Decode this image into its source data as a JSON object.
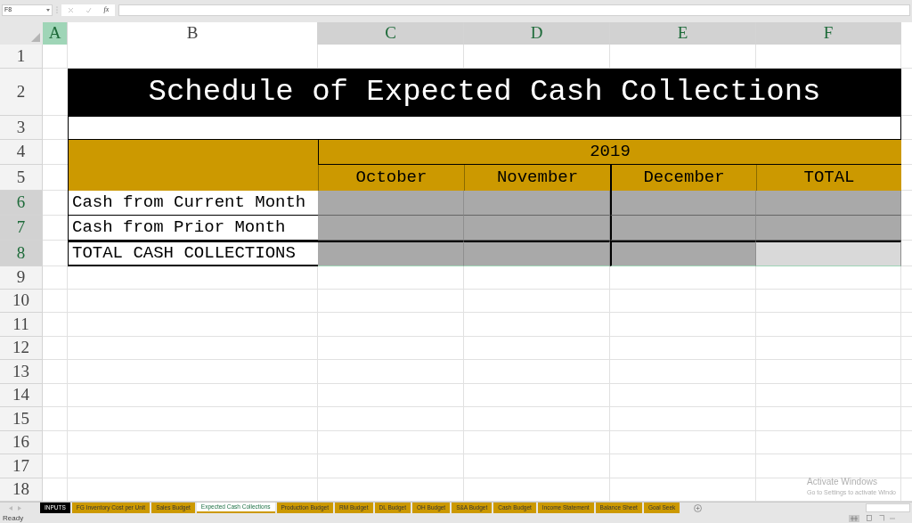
{
  "formula_bar": {
    "name_box": "F8",
    "fx_label": "fx"
  },
  "column_headers": [
    {
      "label": "A",
      "active": true,
      "selected": false
    },
    {
      "label": "B",
      "active": false,
      "selected": false
    },
    {
      "label": "C",
      "active": false,
      "selected": true
    },
    {
      "label": "D",
      "active": false,
      "selected": true
    },
    {
      "label": "E",
      "active": false,
      "selected": true
    },
    {
      "label": "F",
      "active": false,
      "selected": true
    }
  ],
  "rows": [
    {
      "header": "1",
      "kind": "blank",
      "selected": false
    },
    {
      "header": "2",
      "kind": "title",
      "selected": false,
      "text": "Schedule of Expected Cash Collections"
    },
    {
      "header": "3",
      "kind": "spacer",
      "selected": false
    },
    {
      "header": "4",
      "kind": "year",
      "selected": false,
      "text": "2019"
    },
    {
      "header": "5",
      "kind": "months",
      "selected": false,
      "months": [
        "October",
        "November",
        "December",
        "TOTAL"
      ]
    },
    {
      "header": "6",
      "kind": "line",
      "selected": true,
      "label": "Cash from Current Month",
      "cells": [
        {
          "selected": true,
          "active": false
        },
        {
          "selected": true,
          "active": false
        },
        {
          "selected": true,
          "active": false
        },
        {
          "selected": true,
          "active": false
        }
      ]
    },
    {
      "header": "7",
      "kind": "line",
      "selected": true,
      "label": "Cash from Prior Month",
      "cells": [
        {
          "selected": true,
          "active": false
        },
        {
          "selected": true,
          "active": false
        },
        {
          "selected": true,
          "active": false
        },
        {
          "selected": true,
          "active": false
        }
      ]
    },
    {
      "header": "8",
      "kind": "total",
      "selected": true,
      "label": "TOTAL CASH COLLECTIONS",
      "cells": [
        {
          "selected": true,
          "active": false
        },
        {
          "selected": true,
          "active": false
        },
        {
          "selected": true,
          "active": false
        },
        {
          "selected": true,
          "active": true
        }
      ]
    },
    {
      "header": "9",
      "kind": "blank",
      "selected": false
    },
    {
      "header": "10",
      "kind": "blank",
      "selected": false
    },
    {
      "header": "11",
      "kind": "blank",
      "selected": false
    },
    {
      "header": "12",
      "kind": "blank",
      "selected": false
    },
    {
      "header": "13",
      "kind": "blank",
      "selected": false
    },
    {
      "header": "14",
      "kind": "blank",
      "selected": false
    },
    {
      "header": "15",
      "kind": "blank",
      "selected": false
    },
    {
      "header": "16",
      "kind": "blank",
      "selected": false
    },
    {
      "header": "17",
      "kind": "blank",
      "selected": false
    },
    {
      "header": "18",
      "kind": "blank",
      "selected": false
    }
  ],
  "sheet_tabs": [
    {
      "label": "INPUTS",
      "kind": "dark",
      "selected": false
    },
    {
      "label": "FG Inventory Cost per Unit",
      "kind": "gold",
      "selected": false
    },
    {
      "label": "Sales Budget",
      "kind": "gold",
      "selected": false
    },
    {
      "label": "Expected Cash Collections",
      "kind": "gold",
      "selected": true
    },
    {
      "label": "Production Budget",
      "kind": "gold",
      "selected": false
    },
    {
      "label": "RM Budget",
      "kind": "gold",
      "selected": false
    },
    {
      "label": "DL Budget",
      "kind": "gold",
      "selected": false
    },
    {
      "label": "OH Budget",
      "kind": "gold",
      "selected": false
    },
    {
      "label": "S&A Budget",
      "kind": "gold",
      "selected": false
    },
    {
      "label": "Cash Budget",
      "kind": "gold",
      "selected": false
    },
    {
      "label": "Income Statement",
      "kind": "gold",
      "selected": false
    },
    {
      "label": "Balance Sheet",
      "kind": "gold",
      "selected": false
    },
    {
      "label": "Goal Seek",
      "kind": "gold",
      "selected": false
    }
  ],
  "activation_notice": {
    "title": "Activate Windows",
    "subtitle": "Go to Settings to activate Windo"
  },
  "status_bar": {
    "status": "Ready"
  }
}
